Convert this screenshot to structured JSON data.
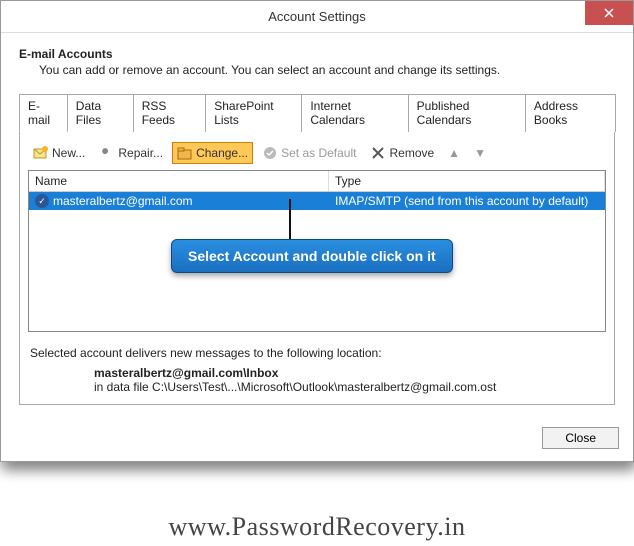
{
  "window": {
    "title": "Account Settings"
  },
  "header": {
    "heading": "E-mail Accounts",
    "sub": "You can add or remove an account. You can select an account and change its settings."
  },
  "tabs": [
    {
      "label": "E-mail"
    },
    {
      "label": "Data Files"
    },
    {
      "label": "RSS Feeds"
    },
    {
      "label": "SharePoint Lists"
    },
    {
      "label": "Internet Calendars"
    },
    {
      "label": "Published Calendars"
    },
    {
      "label": "Address Books"
    }
  ],
  "toolbar": {
    "new_label": "New...",
    "repair_label": "Repair...",
    "change_label": "Change...",
    "default_label": "Set as Default",
    "remove_label": "Remove"
  },
  "table": {
    "col_name": "Name",
    "col_type": "Type",
    "rows": [
      {
        "name": "masteralbertz@gmail.com",
        "type": "IMAP/SMTP (send from this account by default)"
      }
    ]
  },
  "callout": {
    "text": "Select Account and double click on it"
  },
  "footer": {
    "line1": "Selected account delivers new messages to the following location:",
    "location_bold": "masteralbertz@gmail.com\\Inbox",
    "location_path": "in data file C:\\Users\\Test\\...\\Microsoft\\Outlook\\masteralbertz@gmail.com.ost"
  },
  "buttons": {
    "close": "Close"
  },
  "watermark": "www.PasswordRecovery.in"
}
